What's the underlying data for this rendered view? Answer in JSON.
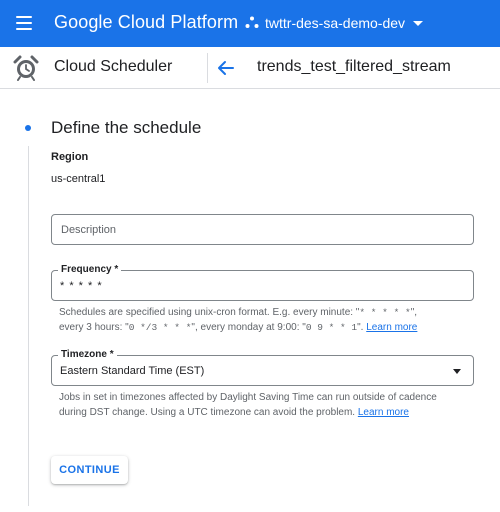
{
  "topbar": {
    "app_title": "Google Cloud Platform",
    "project_name": "twttr-des-sa-demo-dev",
    "bg_color": "#1a73e8"
  },
  "subheader": {
    "product_title": "Cloud Scheduler",
    "job_title": "trends_test_filtered_stream"
  },
  "step": {
    "title": "Define the schedule"
  },
  "region": {
    "label": "Region",
    "value": "us-central1"
  },
  "description": {
    "placeholder": "Description",
    "value": ""
  },
  "frequency": {
    "label": "Frequency *",
    "value": "* * * * *",
    "hint_prefix": "Schedules are specified using unix-cron format. E.g. every minute: \"",
    "hint_code_1": "* * * * *",
    "hint_mid_1": "\",",
    "hint_line2_prefix": "every 3 hours: \"",
    "hint_code_2": "0 */3 * * *",
    "hint_mid_2": "\", every monday at 9:00: \"",
    "hint_code_3": "0 9 * * 1",
    "hint_end": "\". ",
    "learn_more": "Learn more"
  },
  "timezone": {
    "label": "Timezone *",
    "value": "Eastern Standard Time (EST)",
    "hint": "Jobs in set in timezones affected by Daylight Saving Time can run outside of cadence during DST change. Using a UTC timezone can avoid the problem. ",
    "learn_more": "Learn more"
  },
  "actions": {
    "continue_label": "CONTINUE"
  },
  "icons": {
    "menu": "hamburger-menu-icon",
    "project": "project-dots-icon",
    "product": "alarm-clock-icon",
    "back": "arrow-back-icon",
    "dropdown": "dropdown-caret-icon"
  }
}
